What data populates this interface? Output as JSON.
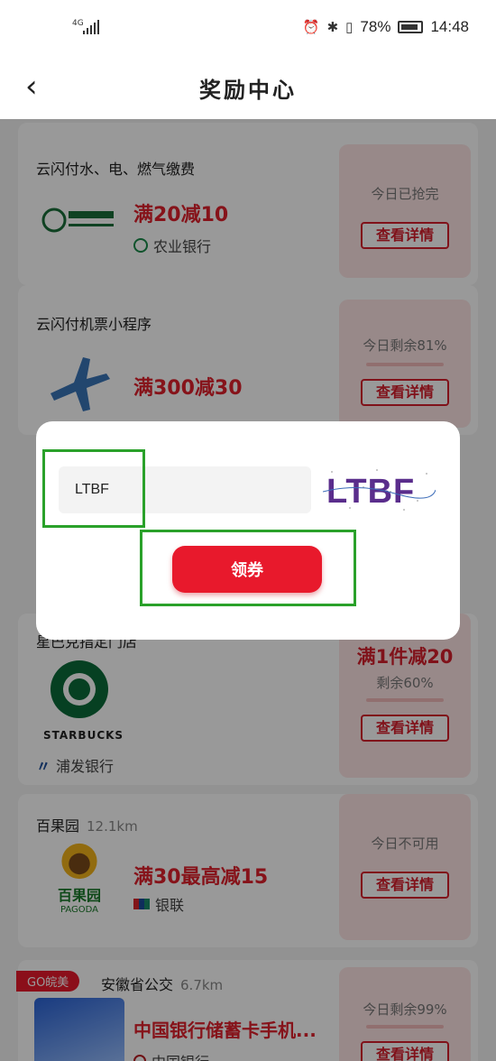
{
  "status_bar": {
    "network": "4G",
    "battery": "78%",
    "time": "14:48"
  },
  "header": {
    "title": "奖励中心"
  },
  "cards": [
    {
      "shop": "云闪付水、电、燃气缴费",
      "offer": "满20减10",
      "bank": "农业银行",
      "status": "今日已抢完",
      "detail": "查看详情"
    },
    {
      "shop": "云闪付机票小程序",
      "offer": "满300减30",
      "status": "今日剩余81%",
      "detail": "查看详情"
    },
    {
      "shop": "星巴克指定门店",
      "offer": "满1件减20",
      "bank": "浦发银行",
      "status": "剩余60%",
      "detail": "查看详情",
      "logo_text": "STARBUCKS"
    },
    {
      "shop": "百果园",
      "distance": "12.1km",
      "offer": "满30最高减15",
      "bank": "银联",
      "status": "今日不可用",
      "detail": "查看详情",
      "logo_text": "百果园",
      "logo_sub": "PAGODA"
    },
    {
      "tag": "GO皖美",
      "shop": "安徽省公交",
      "distance": "6.7km",
      "offer": "中国银行储蓄卡手机...",
      "bank": "中国银行",
      "status": "今日剩余99%",
      "detail": "查看详情"
    }
  ],
  "dialog": {
    "code_value": "LTBF",
    "captcha_text": "LTBF",
    "claim_label": "领券"
  },
  "colors": {
    "accent": "#e8192c",
    "highlight": "#2aa12a",
    "card_pink": "#fde4e4"
  }
}
